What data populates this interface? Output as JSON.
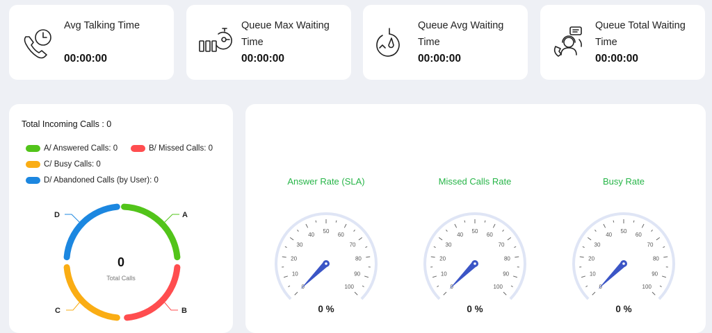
{
  "stats": [
    {
      "label": "Avg Talking Time",
      "value": "00:00:00",
      "icon": "phone-clock-icon"
    },
    {
      "label": "Queue Max Waiting Time",
      "value": "00:00:00",
      "icon": "bars-timer-icon"
    },
    {
      "label": "Queue Avg Waiting Time",
      "value": "00:00:00",
      "icon": "circular-timer-icon"
    },
    {
      "label": "Queue Total Waiting Time",
      "value": "00:00:00",
      "icon": "agent-headset-icon"
    }
  ],
  "incoming": {
    "title": "Total Incoming Calls : 0",
    "legend": [
      {
        "label": "A/ Answered Calls: 0",
        "color": "#52c41a"
      },
      {
        "label": "B/ Missed Calls: 0",
        "color": "#ff4d4f"
      },
      {
        "label": "C/ Busy Calls: 0",
        "color": "#faad14"
      },
      {
        "label": "D/ Abandoned Calls (by User): 0",
        "color": "#1c87e0"
      }
    ],
    "donut": {
      "center_value": "0",
      "center_label": "Total Calls",
      "segment_labels": [
        "A",
        "B",
        "C",
        "D"
      ]
    }
  },
  "rates": [
    {
      "title": "Answer Rate (SLA)",
      "value": "0 %",
      "percent": 0
    },
    {
      "title": "Missed Calls Rate",
      "value": "0 %",
      "percent": 0
    },
    {
      "title": "Busy Rate",
      "value": "0 %",
      "percent": 0
    }
  ],
  "gauge_ticks": [
    "0",
    "10",
    "20",
    "30",
    "40",
    "50",
    "60",
    "70",
    "80",
    "90",
    "100"
  ],
  "colors": {
    "gauge_needle": "#3b55c6",
    "gauge_arc": "#dfe5f5",
    "title_green": "#27b548"
  }
}
